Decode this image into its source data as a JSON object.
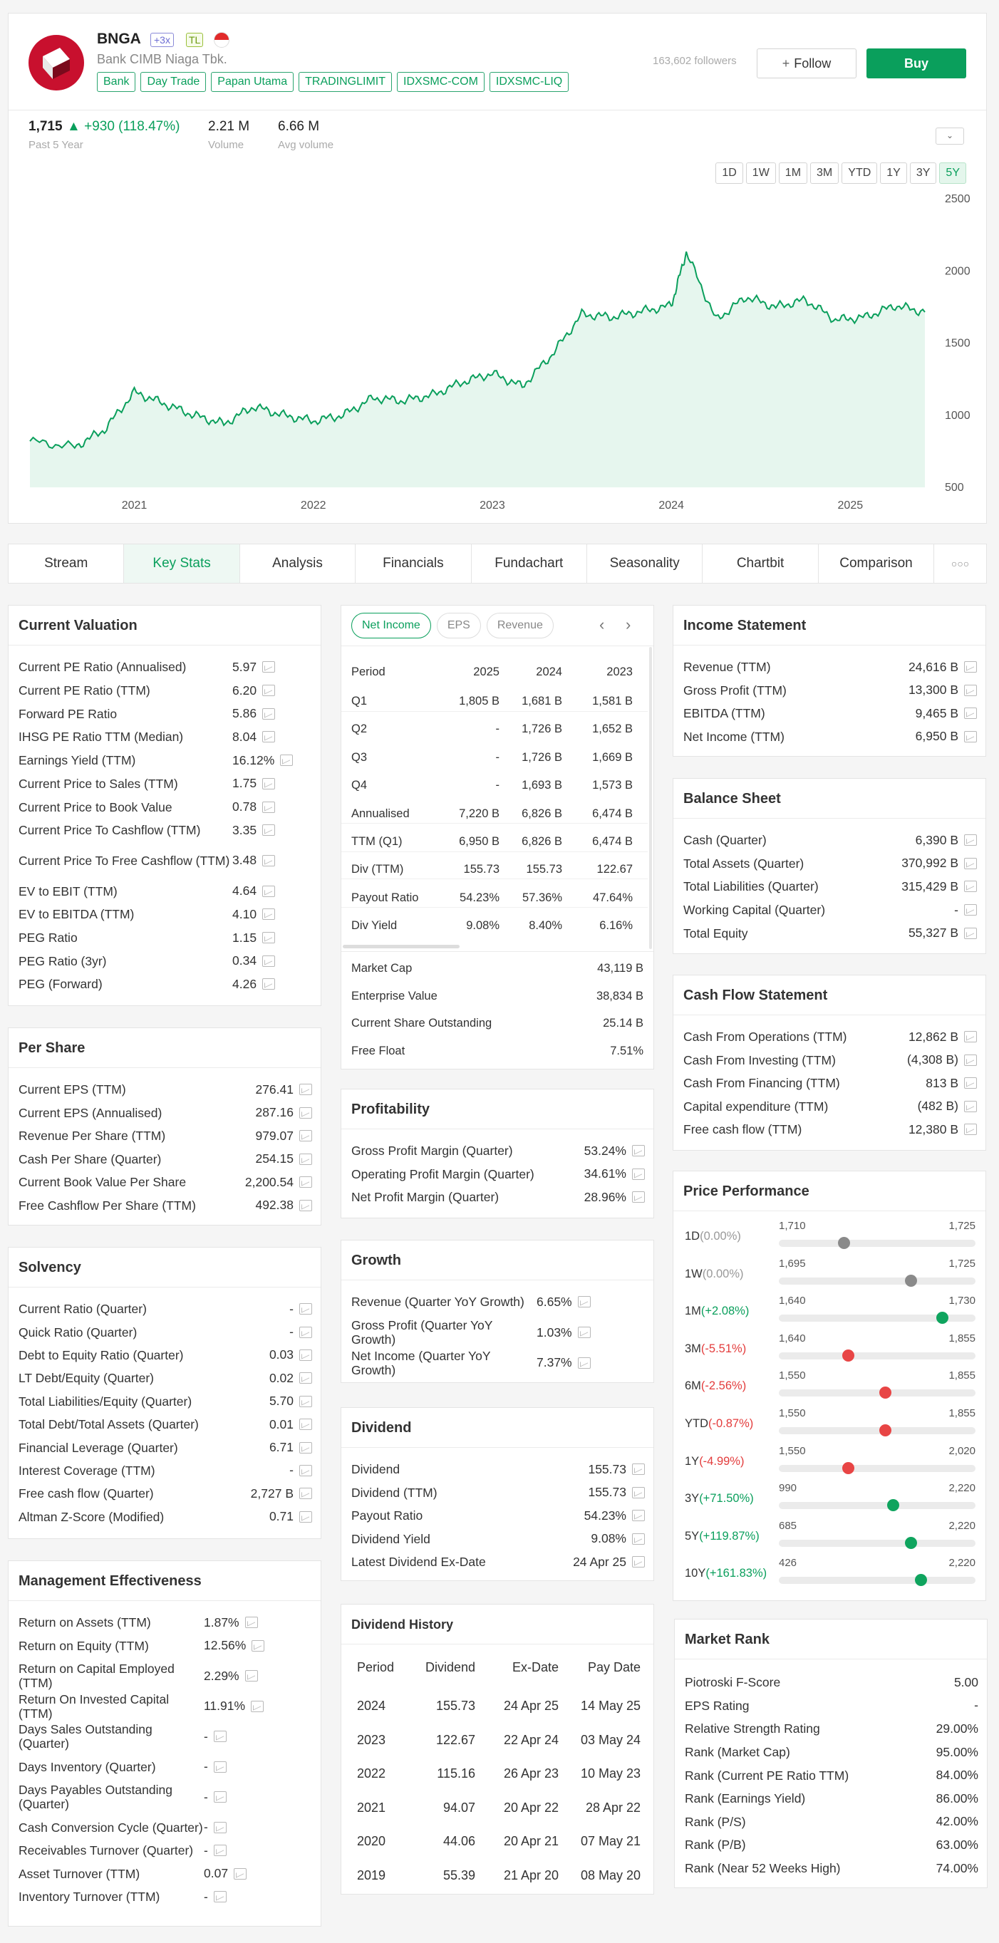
{
  "header": {
    "ticker": "BNGA",
    "badge_multiplier": "+3x",
    "badge_tl": "TL",
    "company": "Bank CIMB Niaga Tbk.",
    "tags": [
      "Bank",
      "Day Trade",
      "Papan Utama",
      "TRADINGLIMIT",
      "IDXSMC-COM",
      "IDXSMC-LIQ"
    ],
    "followers": "163,602 followers",
    "follow_label": "Follow",
    "buy_label": "Buy",
    "brand_color": "#c8102e",
    "accent": "#0a9f5c"
  },
  "quote": {
    "price": "1,715",
    "change": "+930 (118.47%)",
    "period": "Past 5 Year",
    "volume": "2.21 M",
    "volume_label": "Volume",
    "avg_volume": "6.66 M",
    "avg_volume_label": "Avg volume"
  },
  "timeframes": [
    "1D",
    "1W",
    "1M",
    "3M",
    "YTD",
    "1Y",
    "3Y",
    "5Y"
  ],
  "chart_data": {
    "type": "area",
    "xlabel": "",
    "ylabel": "",
    "ylim": [
      500,
      2500
    ],
    "yticks": [
      500,
      1000,
      1500,
      2000,
      2500
    ],
    "xticks": [
      "2021",
      "2022",
      "2023",
      "2024",
      "2025"
    ],
    "xrange": [
      "2020-06",
      "2025-06"
    ],
    "grid": false,
    "color": "#0a9f5c",
    "x": [
      "2020-06",
      "2020-09",
      "2020-11",
      "2021-01",
      "2021-03",
      "2021-05",
      "2021-07",
      "2021-09",
      "2021-11",
      "2022-01",
      "2022-03",
      "2022-05",
      "2022-07",
      "2022-09",
      "2022-11",
      "2023-01",
      "2023-03",
      "2023-05",
      "2023-07",
      "2023-09",
      "2023-11",
      "2024-01",
      "2024-02",
      "2024-04",
      "2024-06",
      "2024-08",
      "2024-10",
      "2024-12",
      "2025-02",
      "2025-04",
      "2025-06"
    ],
    "y": [
      820,
      780,
      900,
      1160,
      1080,
      1000,
      940,
      1060,
      1000,
      960,
      1000,
      1120,
      1100,
      1140,
      1230,
      1290,
      1200,
      1420,
      1700,
      1680,
      1720,
      1760,
      2130,
      1660,
      1820,
      1750,
      1800,
      1660,
      1680,
      1760,
      1715
    ]
  },
  "tabs": [
    "Stream",
    "Key Stats",
    "Analysis",
    "Financials",
    "Fundachart",
    "Seasonality",
    "Chartbit",
    "Comparison"
  ],
  "tabs_more": "○○○",
  "current_valuation": {
    "title": "Current Valuation",
    "rows": [
      [
        "Current PE Ratio (Annualised)",
        "5.97"
      ],
      [
        "Current PE Ratio (TTM)",
        "6.20"
      ],
      [
        "Forward PE Ratio",
        "5.86"
      ],
      [
        "IHSG PE Ratio TTM (Median)",
        "8.04"
      ],
      [
        "Earnings Yield (TTM)",
        "16.12%"
      ],
      [
        "Current Price to Sales (TTM)",
        "1.75"
      ],
      [
        "Current Price to Book Value",
        "0.78"
      ],
      [
        "Current Price To Cashflow (TTM)",
        "3.35"
      ],
      [
        "Current Price To Free Cashflow (TTM)",
        "3.48"
      ],
      [
        "EV to EBIT (TTM)",
        "4.64"
      ],
      [
        "EV to EBITDA (TTM)",
        "4.10"
      ],
      [
        "PEG Ratio",
        "1.15"
      ],
      [
        "PEG Ratio (3yr)",
        "0.34"
      ],
      [
        "PEG (Forward)",
        "4.26"
      ]
    ]
  },
  "per_share": {
    "title": "Per Share",
    "rows": [
      [
        "Current EPS (TTM)",
        "276.41"
      ],
      [
        "Current EPS (Annualised)",
        "287.16"
      ],
      [
        "Revenue Per Share (TTM)",
        "979.07"
      ],
      [
        "Cash Per Share (Quarter)",
        "254.15"
      ],
      [
        "Current Book Value Per Share",
        "2,200.54"
      ],
      [
        "Free Cashflow Per Share (TTM)",
        "492.38"
      ]
    ]
  },
  "solvency": {
    "title": "Solvency",
    "rows": [
      [
        "Current Ratio (Quarter)",
        "-"
      ],
      [
        "Quick Ratio (Quarter)",
        "-"
      ],
      [
        "Debt to Equity Ratio (Quarter)",
        "0.03"
      ],
      [
        "LT Debt/Equity (Quarter)",
        "0.02"
      ],
      [
        "Total Liabilities/Equity (Quarter)",
        "5.70"
      ],
      [
        "Total Debt/Total Assets (Quarter)",
        "0.01"
      ],
      [
        "Financial Leverage (Quarter)",
        "6.71"
      ],
      [
        "Interest Coverage (TTM)",
        "-"
      ],
      [
        "Free cash flow (Quarter)",
        "2,727 B"
      ],
      [
        "Altman Z-Score (Modified)",
        "0.71"
      ]
    ]
  },
  "management": {
    "title": "Management Effectiveness",
    "rows": [
      [
        "Return on Assets (TTM)",
        "1.87%"
      ],
      [
        "Return on Equity (TTM)",
        "12.56%"
      ],
      [
        "Return on Capital Employed (TTM)",
        "2.29%"
      ],
      [
        "Return On Invested Capital (TTM)",
        "11.91%"
      ],
      [
        "Days Sales Outstanding (Quarter)",
        "-"
      ],
      [
        "Days Inventory (Quarter)",
        "-"
      ],
      [
        "Days Payables Outstanding (Quarter)",
        "-"
      ],
      [
        "Cash Conversion Cycle (Quarter)",
        "-"
      ],
      [
        "Receivables Turnover (Quarter)",
        "-"
      ],
      [
        "Asset Turnover (TTM)",
        "0.07"
      ],
      [
        "Inventory Turnover (TTM)",
        "-"
      ]
    ]
  },
  "net_income": {
    "tabs": [
      "Net Income",
      "EPS",
      "Revenue"
    ],
    "headers": [
      "Period",
      "2025",
      "2024",
      "2023"
    ],
    "rows": [
      [
        "Q1",
        "1,805 B",
        "1,681 B",
        "1,581 B"
      ],
      [
        "Q2",
        "-",
        "1,726 B",
        "1,652 B"
      ],
      [
        "Q3",
        "-",
        "1,726 B",
        "1,669 B"
      ],
      [
        "Q4",
        "-",
        "1,693 B",
        "1,573 B"
      ],
      [
        "Annualised",
        "7,220 B",
        "6,826 B",
        "6,474 B"
      ],
      [
        "TTM (Q1)",
        "6,950 B",
        "6,826 B",
        "6,474 B"
      ],
      [
        "Div (TTM)",
        "155.73",
        "155.73",
        "122.67"
      ],
      [
        "Payout Ratio",
        "54.23%",
        "57.36%",
        "47.64%"
      ],
      [
        "Div Yield",
        "9.08%",
        "8.40%",
        "6.16%"
      ]
    ],
    "summary": [
      [
        "Market Cap",
        "43,119 B"
      ],
      [
        "Enterprise Value",
        "38,834 B"
      ],
      [
        "Current Share Outstanding",
        "25.14 B"
      ],
      [
        "Free Float",
        "7.51%"
      ]
    ]
  },
  "profitability": {
    "title": "Profitability",
    "rows": [
      [
        "Gross Profit Margin (Quarter)",
        "53.24%"
      ],
      [
        "Operating Profit Margin (Quarter)",
        "34.61%"
      ],
      [
        "Net Profit Margin (Quarter)",
        "28.96%"
      ]
    ]
  },
  "growth": {
    "title": "Growth",
    "rows": [
      [
        "Revenue (Quarter YoY Growth)",
        "6.65%"
      ],
      [
        "Gross Profit (Quarter YoY Growth)",
        "1.03%"
      ],
      [
        "Net Income (Quarter YoY Growth)",
        "7.37%"
      ]
    ]
  },
  "dividend": {
    "title": "Dividend",
    "rows": [
      [
        "Dividend",
        "155.73"
      ],
      [
        "Dividend (TTM)",
        "155.73"
      ],
      [
        "Payout Ratio",
        "54.23%"
      ],
      [
        "Dividend Yield",
        "9.08%"
      ],
      [
        "Latest Dividend Ex-Date",
        "24 Apr 25"
      ]
    ]
  },
  "dividend_history": {
    "title": "Dividend History",
    "headers": [
      "Period",
      "Dividend",
      "Ex-Date",
      "Pay Date"
    ],
    "rows": [
      [
        "2024",
        "155.73",
        "24 Apr 25",
        "14 May 25"
      ],
      [
        "2023",
        "122.67",
        "22 Apr 24",
        "03 May 24"
      ],
      [
        "2022",
        "115.16",
        "26 Apr 23",
        "10 May 23"
      ],
      [
        "2021",
        "94.07",
        "20 Apr 22",
        "28 Apr 22"
      ],
      [
        "2020",
        "44.06",
        "20 Apr 21",
        "07 May 21"
      ],
      [
        "2019",
        "55.39",
        "21 Apr 20",
        "08 May 20"
      ]
    ]
  },
  "income_statement": {
    "title": "Income Statement",
    "rows": [
      [
        "Revenue (TTM)",
        "24,616 B"
      ],
      [
        "Gross Profit (TTM)",
        "13,300 B"
      ],
      [
        "EBITDA (TTM)",
        "9,465 B"
      ],
      [
        "Net Income (TTM)",
        "6,950 B"
      ]
    ]
  },
  "balance_sheet": {
    "title": "Balance Sheet",
    "rows": [
      [
        "Cash (Quarter)",
        "6,390 B"
      ],
      [
        "Total Assets (Quarter)",
        "370,992 B"
      ],
      [
        "Total Liabilities (Quarter)",
        "315,429 B"
      ],
      [
        "Working Capital (Quarter)",
        "-"
      ],
      [
        "Total Equity",
        "55,327 B"
      ]
    ]
  },
  "cash_flow": {
    "title": "Cash Flow Statement",
    "rows": [
      [
        "Cash From Operations (TTM)",
        "12,862 B"
      ],
      [
        "Cash From Investing (TTM)",
        "(4,308 B)"
      ],
      [
        "Cash From Financing (TTM)",
        "813 B"
      ],
      [
        "Capital expenditure (TTM)",
        "(482 B)"
      ],
      [
        "Free cash flow (TTM)",
        "12,380 B"
      ]
    ]
  },
  "price_performance": {
    "title": "Price Performance",
    "rows": [
      {
        "p": "1D",
        "chg": "(0.00%)",
        "dir": "flat",
        "lo": "1,710",
        "hi": "1,725",
        "pos": 0.33
      },
      {
        "p": "1W",
        "chg": "(0.00%)",
        "dir": "flat",
        "lo": "1,695",
        "hi": "1,725",
        "pos": 0.67
      },
      {
        "p": "1M",
        "chg": "(+2.08%)",
        "dir": "up",
        "lo": "1,640",
        "hi": "1,730",
        "pos": 0.83
      },
      {
        "p": "3M",
        "chg": "(-5.51%)",
        "dir": "down",
        "lo": "1,640",
        "hi": "1,855",
        "pos": 0.35
      },
      {
        "p": "6M",
        "chg": "(-2.56%)",
        "dir": "down",
        "lo": "1,550",
        "hi": "1,855",
        "pos": 0.54
      },
      {
        "p": "YTD",
        "chg": "(-0.87%)",
        "dir": "down",
        "lo": "1,550",
        "hi": "1,855",
        "pos": 0.54
      },
      {
        "p": "1Y",
        "chg": "(-4.99%)",
        "dir": "down",
        "lo": "1,550",
        "hi": "2,020",
        "pos": 0.35
      },
      {
        "p": "3Y",
        "chg": "(+71.50%)",
        "dir": "up",
        "lo": "990",
        "hi": "2,220",
        "pos": 0.58
      },
      {
        "p": "5Y",
        "chg": "(+119.87%)",
        "dir": "up",
        "lo": "685",
        "hi": "2,220",
        "pos": 0.67
      },
      {
        "p": "10Y",
        "chg": "(+161.83%)",
        "dir": "up",
        "lo": "426",
        "hi": "2,220",
        "pos": 0.72
      }
    ]
  },
  "market_rank": {
    "title": "Market Rank",
    "rows": [
      [
        "Piotroski F-Score",
        "5.00"
      ],
      [
        "EPS Rating",
        "-"
      ],
      [
        "Relative Strength Rating",
        "29.00%"
      ],
      [
        "Rank (Market Cap)",
        "95.00%"
      ],
      [
        "Rank (Current PE Ratio TTM)",
        "84.00%"
      ],
      [
        "Rank (Earnings Yield)",
        "86.00%"
      ],
      [
        "Rank (P/S)",
        "42.00%"
      ],
      [
        "Rank (P/B)",
        "63.00%"
      ],
      [
        "Rank (Near 52 Weeks High)",
        "74.00%"
      ]
    ]
  }
}
